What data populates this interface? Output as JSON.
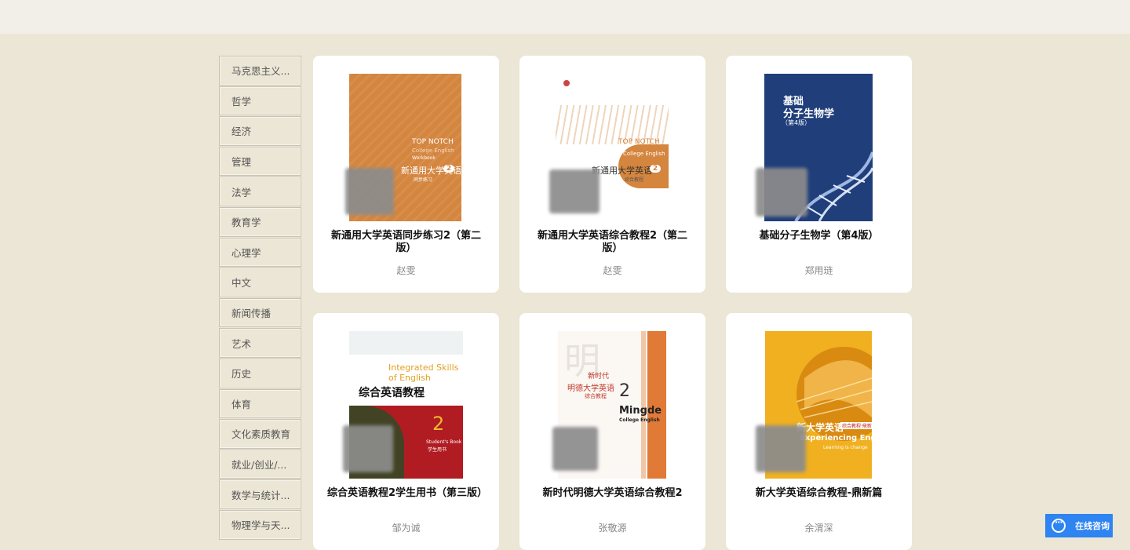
{
  "categories": [
    "马克思主义...",
    "哲学",
    "经济",
    "管理",
    "法学",
    "教育学",
    "心理学",
    "中文",
    "新闻传播",
    "艺术",
    "历史",
    "体育",
    "文化素质教育",
    "就业/创业/...",
    "数学与统计...",
    "物理学与天..."
  ],
  "books": [
    {
      "title": "新通用大学英语同步练习2（第二版）",
      "author": "赵雯"
    },
    {
      "title": "新通用大学英语综合教程2（第二版）",
      "author": "赵雯"
    },
    {
      "title": "基础分子生物学（第4版）",
      "author": "郑用琏"
    },
    {
      "title": "综合英语教程2学生用书（第三版）",
      "author": "邹为诚"
    },
    {
      "title": "新时代明德大学英语综合教程2",
      "author": "张敬源"
    },
    {
      "title": "新大学英语综合教程-鼎新篇",
      "author": "余渭深"
    }
  ],
  "covers": {
    "c1": {
      "line1": "TOP NOTCH",
      "line2": "College English",
      "line3": "Workbook",
      "cn": "新通用大学英语",
      "num": "2",
      "sub": "同步练习"
    },
    "c2": {
      "line1": "TOP NOTCH",
      "line2": "College English",
      "cn": "新通用大学英语",
      "num": "2",
      "sub": "综合教程"
    },
    "c3": {
      "cn1": "基础",
      "cn2": "分子生物学",
      "ed": "（第4版）"
    },
    "c4": {
      "en1": "Integrated Skills",
      "en2": "of English",
      "cn": "综合英语教程",
      "num": "2",
      "sub": "Student's Book",
      "sub2": "学生用书"
    },
    "c5": {
      "cn1": "新时代",
      "cn2": "明德大学英语",
      "cn3": "综合教程",
      "num": "2",
      "en1": "Mingde",
      "en2": "College English",
      "big": "明"
    },
    "c6": {
      "cn": "新大学英语",
      "tag": "综合教程·鼎新篇",
      "en": "Experiencing English",
      "en2": "Learning is change"
    }
  },
  "chat": {
    "label": "在线咨询"
  },
  "colors": {
    "page_bg": "#ebe6d5",
    "topbar": "#f2efe9",
    "chat_blue": "#2e84f0"
  }
}
